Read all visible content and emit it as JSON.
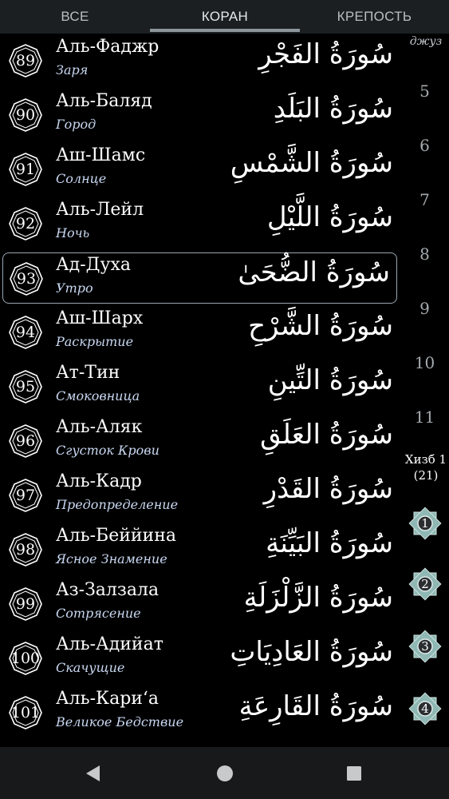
{
  "tabs": [
    {
      "label": "ВСЕ"
    },
    {
      "label": "КОРАН"
    },
    {
      "label": "КРЕПОСТЬ"
    }
  ],
  "surahs": [
    {
      "number": "89",
      "name": "Аль-Фаджр",
      "translation": "Заря",
      "arabic": "سُورَةُ الفَجْرِ"
    },
    {
      "number": "90",
      "name": "Аль-Баляд",
      "translation": "Город",
      "arabic": "سُورَةُ البَلَدِ"
    },
    {
      "number": "91",
      "name": "Аш-Шамс",
      "translation": "Солнце",
      "arabic": "سُورَةُ الشَّمْسِ"
    },
    {
      "number": "92",
      "name": "Аль-Лейл",
      "translation": "Ночь",
      "arabic": "سُورَةُ اللَّيْلِ"
    },
    {
      "number": "93",
      "name": "Ад-Духа",
      "translation": "Утро",
      "arabic": "سُورَةُ الضُّحَىٰ"
    },
    {
      "number": "94",
      "name": "Аш-Шарх",
      "translation": "Раскрытие",
      "arabic": "سُورَةُ الشَّرْحِ"
    },
    {
      "number": "95",
      "name": "Ат-Тин",
      "translation": "Смоковница",
      "arabic": "سُورَةُ التِّينِ"
    },
    {
      "number": "96",
      "name": "Аль-Аляк",
      "translation": "Сгусток Крови",
      "arabic": "سُورَةُ العَلَقِ"
    },
    {
      "number": "97",
      "name": "Аль-Кадр",
      "translation": "Предопределение",
      "arabic": "سُورَةُ القَدْرِ"
    },
    {
      "number": "98",
      "name": "Аль-Беййина",
      "translation": "Ясное Знамение",
      "arabic": "سُورَةُ البَيِّنَةِ"
    },
    {
      "number": "99",
      "name": "Аз-Залзала",
      "translation": "Сотрясение",
      "arabic": "سُورَةُ الزَّلْزَلَةِ"
    },
    {
      "number": "100",
      "name": "Аль-Адийат",
      "translation": "Скачущие",
      "arabic": "سُورَةُ العَادِيَاتِ"
    },
    {
      "number": "101",
      "name": "Аль-Кари‘а",
      "translation": "Великое Бедствие",
      "arabic": "سُورَةُ القَارِعَةِ"
    }
  ],
  "selected_surah": "93",
  "sidebar": {
    "juz_header": "джуз",
    "juz_numbers": [
      "5",
      "6",
      "7",
      "8",
      "9",
      "10",
      "11"
    ],
    "hizb_label": "Хизб 1",
    "hizb_sub": "(21)",
    "hizb_markers": [
      "1",
      "2",
      "3",
      "4"
    ]
  },
  "colors": {
    "background": "#000000",
    "tabbar": "#1b1f22",
    "translation_text": "#c9d8f2",
    "hizb_star": "#8fb8b4",
    "selected_border": "#9aa7b2"
  },
  "navbar": {
    "icons": [
      "back-triangle-icon",
      "home-circle-icon",
      "recents-square-icon"
    ]
  }
}
